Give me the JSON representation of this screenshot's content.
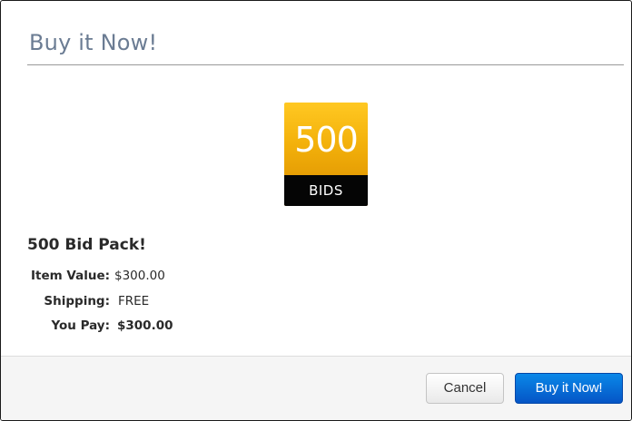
{
  "modal": {
    "title": "Buy it Now!"
  },
  "product": {
    "badge": {
      "number": "500",
      "word": "BIDS",
      "colors": {
        "gold_top": "#ffc822",
        "gold_bottom": "#de9000",
        "strip": "#050505"
      }
    },
    "name": "500 Bid Pack!",
    "details": [
      {
        "label": "Item Value:",
        "value": "$300.00"
      },
      {
        "label": "Shipping:",
        "value": "FREE"
      },
      {
        "label": "You Pay:",
        "value": "$300.00"
      }
    ]
  },
  "footer": {
    "cancel_label": "Cancel",
    "buy_label": "Buy it Now!",
    "colors": {
      "primary": "#0668d8",
      "background": "#f5f5f5"
    }
  }
}
